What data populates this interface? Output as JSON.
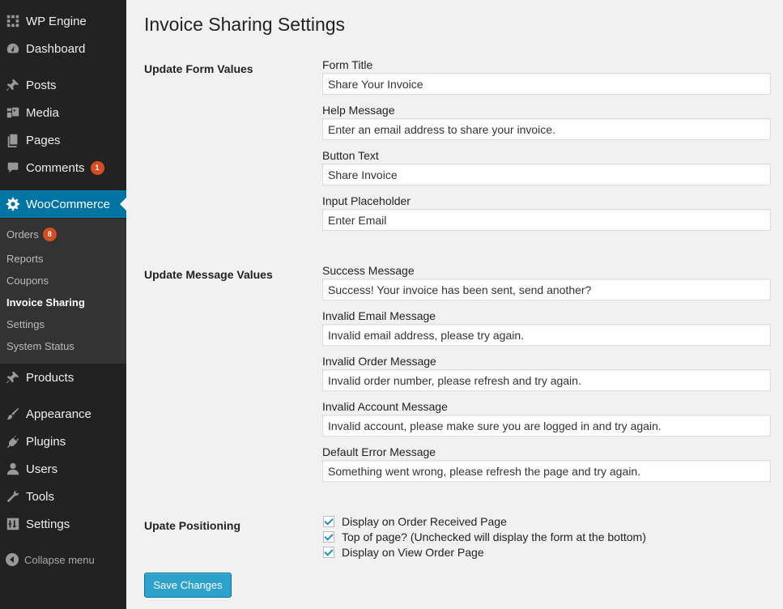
{
  "sidebar": {
    "items": [
      {
        "label": "WP Engine",
        "icon": "wpengine-icon"
      },
      {
        "label": "Dashboard",
        "icon": "dashboard-icon"
      },
      {
        "label": "Posts",
        "icon": "pin-icon"
      },
      {
        "label": "Media",
        "icon": "media-icon"
      },
      {
        "label": "Pages",
        "icon": "pages-icon"
      },
      {
        "label": "Comments",
        "icon": "comment-icon",
        "badge": "1"
      },
      {
        "label": "WooCommerce",
        "icon": "gear-icon"
      },
      {
        "label": "Products",
        "icon": "pin-icon"
      },
      {
        "label": "Appearance",
        "icon": "brush-icon"
      },
      {
        "label": "Plugins",
        "icon": "plug-icon"
      },
      {
        "label": "Users",
        "icon": "user-icon"
      },
      {
        "label": "Tools",
        "icon": "wrench-icon"
      },
      {
        "label": "Settings",
        "icon": "sliders-icon"
      }
    ],
    "submenu": [
      {
        "label": "Orders",
        "badge": "8"
      },
      {
        "label": "Reports"
      },
      {
        "label": "Coupons"
      },
      {
        "label": "Invoice Sharing"
      },
      {
        "label": "Settings"
      },
      {
        "label": "System Status"
      }
    ],
    "collapse_label": "Collapse menu"
  },
  "page": {
    "title": "Invoice Sharing Settings",
    "sections": {
      "form": "Update Form Values",
      "messages": "Update Message Values",
      "positioning": "Upate Positioning"
    },
    "fields": [
      {
        "label": "Form Title",
        "value": "Share Your Invoice"
      },
      {
        "label": "Help Message",
        "value": "Enter an email address to share your invoice."
      },
      {
        "label": "Button Text",
        "value": "Share Invoice"
      },
      {
        "label": "Input Placeholder",
        "value": "Enter Email"
      },
      {
        "label": "Success Message",
        "value": "Success! Your invoice has been sent, send another?"
      },
      {
        "label": "Invalid Email Message",
        "value": "Invalid email address, please try again."
      },
      {
        "label": "Invalid Order Message",
        "value": "Invalid order number, please refresh and try again."
      },
      {
        "label": "Invalid Account Message",
        "value": "Invalid account, please make sure you are logged in and try again."
      },
      {
        "label": "Default Error Message",
        "value": "Something went wrong, please refresh the page and try again."
      }
    ],
    "checkboxes": [
      {
        "label": "Display on Order Received Page",
        "checked": true
      },
      {
        "label": "Top of page? (Unchecked will display the form at the bottom)",
        "checked": true
      },
      {
        "label": "Display on View Order Page",
        "checked": true
      }
    ],
    "save_label": "Save Changes"
  },
  "colors": {
    "sidebar_bg": "#222222",
    "submenu_bg": "#333333",
    "active_bg": "#0074a2",
    "badge": "#d54e21",
    "button": "#2ea2cc"
  }
}
